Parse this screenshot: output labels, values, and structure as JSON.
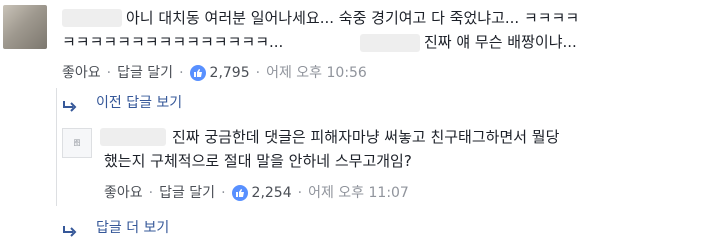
{
  "comment": {
    "text_line1": "아니 대치동 여러분 일어나세요... 숙중 경기여고 다 죽었냐고... ㅋㅋㅋㅋ",
    "text_line2_start": "ㅋㅋㅋㅋㅋㅋㅋㅋㅋㅋㅋㅋㅋㅋㅋ...",
    "text_line2_end": "진짜 얘 무슨 배짱이냐...",
    "like_label": "좋아요",
    "reply_label": "답글 달기",
    "reactions": "2,795",
    "timestamp": "어제 오후 10:56"
  },
  "previous_replies_label": "이전 답글 보기",
  "reply": {
    "avatar_text": "图",
    "text_line1": "진짜 궁금한데 댓글은 피해자마냥 써놓고 친구태그하면서 뭘당",
    "text_line2": "했는지 구체적으로 절대 말을 안하네 스무고개임?",
    "like_label": "좋아요",
    "reply_label": "답글 달기",
    "reactions": "2,254",
    "timestamp": "어제 오후 11:07"
  },
  "more_replies_label": "답글 더 보기",
  "colors": {
    "link_blue": "#365899",
    "meta_gray": "#90949c",
    "like_blue": "#5890ff"
  },
  "icons": {
    "reply_arrow": "reply-arrow-icon",
    "like": "thumbs-up-icon"
  }
}
